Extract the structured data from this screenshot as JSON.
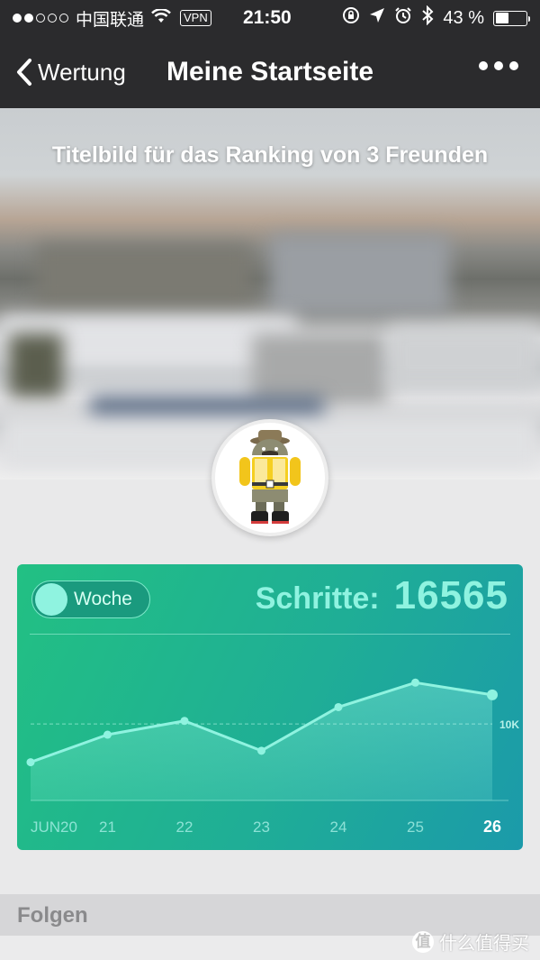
{
  "status_bar": {
    "carrier": "中国联通",
    "vpn": "VPN",
    "time": "21:50",
    "battery": "43 %",
    "battery_level": 0.43
  },
  "nav": {
    "back_label": "Wertung",
    "title": "Meine Startseite"
  },
  "cover": {
    "caption": "Titelbild für das Ranking von 3 Freunden"
  },
  "card": {
    "toggle_label": "Woche",
    "steps_label": "Schritte:",
    "steps_value": "16565"
  },
  "chart_data": {
    "type": "area",
    "x": [
      "JUN20",
      "21",
      "22",
      "23",
      "24",
      "25",
      "26"
    ],
    "values": [
      5000,
      8600,
      10400,
      6500,
      12200,
      15400,
      13800
    ],
    "reference_line": {
      "value": 10000,
      "label": "10K"
    },
    "highlighted_x": "26",
    "colors": {
      "line": "#8ff3e0",
      "fill": "#8ff3e0"
    }
  },
  "section": {
    "follow_label": "Folgen"
  },
  "watermark": {
    "badge": "值",
    "text": "什么值得买"
  }
}
